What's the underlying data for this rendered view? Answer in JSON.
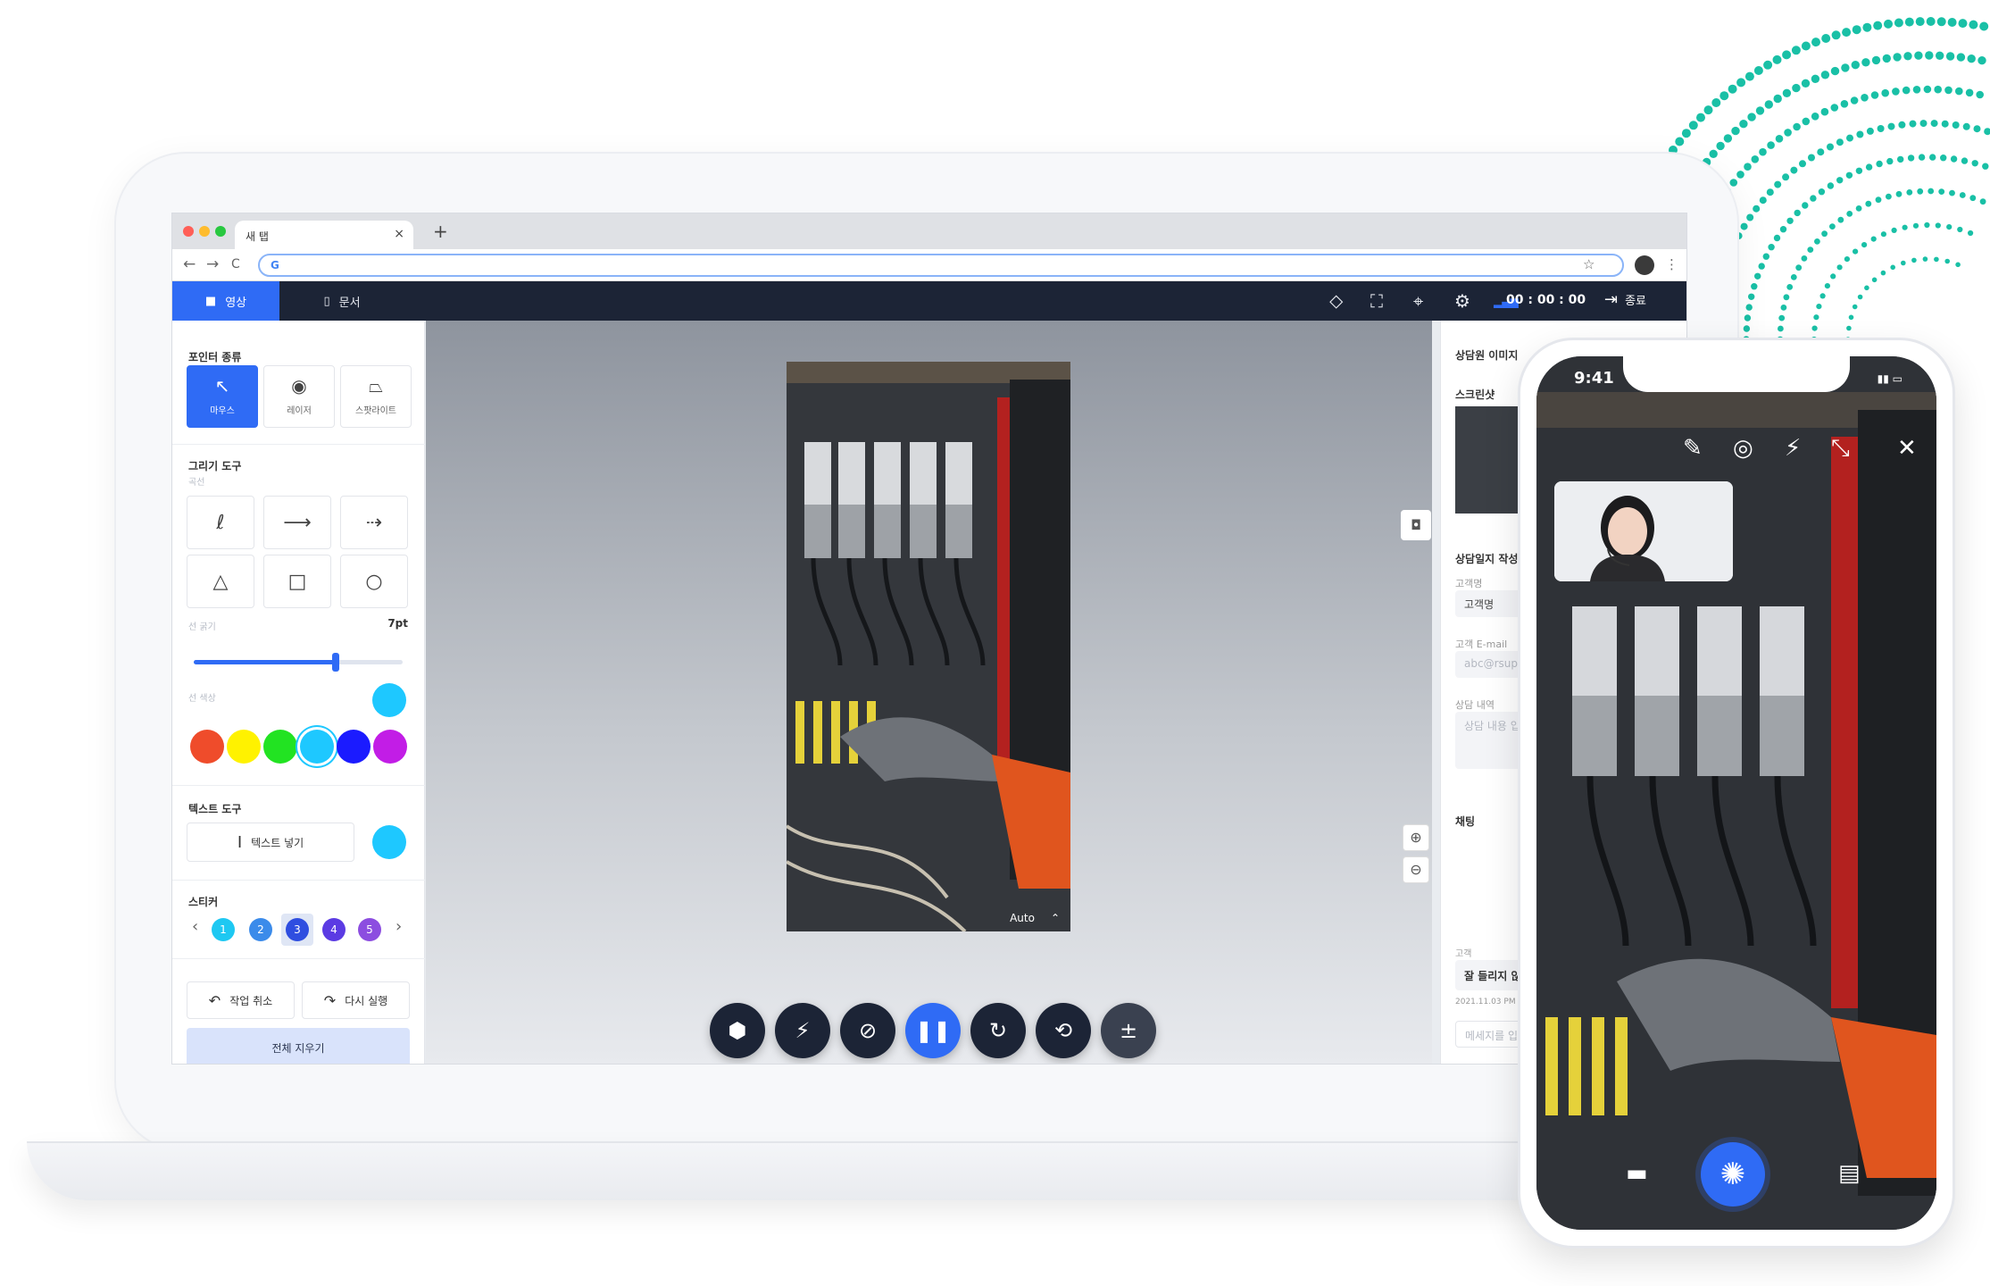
{
  "browser": {
    "tab_title": "새 탭",
    "tab_close": "×",
    "new_tab": "+",
    "address": "G",
    "back": "←",
    "forward": "→",
    "reload": "C",
    "star": "☆",
    "menu": "⋮"
  },
  "app_nav": {
    "tabs": [
      {
        "label": "영상",
        "icon": "video-camera-icon",
        "active": true
      },
      {
        "label": "문서",
        "icon": "document-icon",
        "active": false
      }
    ],
    "timer": "00 : 00 : 00",
    "end_label": "종료",
    "icons": [
      "navigation-icon",
      "scan-icon",
      "location-pin-icon",
      "settings-gear-icon",
      "signal-bars-icon",
      "exit-icon"
    ]
  },
  "left_panel": {
    "pointer_section": "포인터 종류",
    "pointers": [
      {
        "label": "마우스",
        "icon": "cursor-icon",
        "selected": true
      },
      {
        "label": "레이저",
        "icon": "laser-icon",
        "selected": false
      },
      {
        "label": "스팟라이트",
        "icon": "spotlight-icon",
        "selected": false
      }
    ],
    "draw_section": "그리기 도구",
    "draw_sub": "곡선",
    "draw_tools": [
      "curve-icon",
      "arrow-icon",
      "dashed-arrow-icon",
      "triangle-icon",
      "square-icon",
      "circle-icon"
    ],
    "thickness_label": "선 굵기",
    "thickness_value": "7pt",
    "thickness_fraction": 0.68,
    "color_label": "선 색상",
    "current_color": "#1ec8ff",
    "colors": [
      "#ef4c2b",
      "#fff200",
      "#22e322",
      "#1ec8ff",
      "#1b1bff",
      "#c21de6"
    ],
    "text_section": "텍스트 도구",
    "text_insert": "텍스트 넣기",
    "text_color": "#1ec8ff",
    "sticker_section": "스티커",
    "stickers": [
      {
        "label": "1",
        "color": "#1ec8f2"
      },
      {
        "label": "2",
        "color": "#3b8bea"
      },
      {
        "label": "3",
        "color": "#2f4ee0"
      },
      {
        "label": "4",
        "color": "#5b3be3"
      },
      {
        "label": "5",
        "color": "#8c4de0"
      }
    ],
    "sticker_prev": "‹",
    "sticker_next": "›",
    "undo_label": "작업 취소",
    "redo_label": "다시 실행",
    "clear_all": "전체 지우기"
  },
  "center": {
    "quality": "Auto",
    "controls": [
      "hexagon-icon",
      "flash-off-icon",
      "mic-off-icon",
      "pause-icon",
      "rotate-icon",
      "switch-camera-icon",
      "zoom-icon"
    ]
  },
  "right_panel": {
    "agent_image": "상담원 이미지",
    "screenshot": "스크린샷",
    "form_title": "상담일지 작성",
    "customer_label": "고객명",
    "customer_value": "고객명",
    "email_label": "고객 E-mail",
    "email_placeholder": "abc@rsupp",
    "content_label": "상담 내역",
    "content_placeholder": "상담 내용 입",
    "chat": "채팅",
    "chat_sender": "고객",
    "chat_message": "잘 들리지 않",
    "chat_time": "2021.11.03 PM 5",
    "message_placeholder": "메세지를 입"
  },
  "phone": {
    "time": "9:41",
    "icons": [
      "pencil-icon",
      "target-icon",
      "flash-icon",
      "collapse-icon",
      "close-icon"
    ],
    "bottom_icons": [
      "folder-icon",
      "shutter-icon",
      "chat-icon"
    ]
  }
}
